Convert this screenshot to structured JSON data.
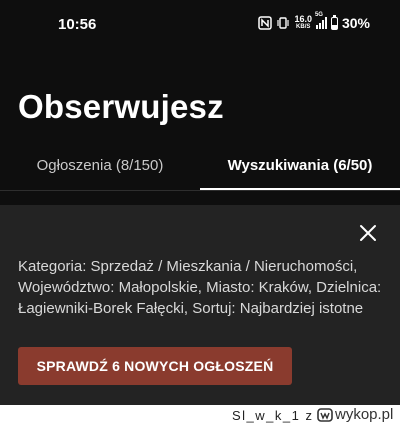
{
  "status_bar": {
    "time": "10:56",
    "net_speed_value": "16.0",
    "net_speed_unit": "KB/S",
    "network_gen": "5G",
    "battery": "30%",
    "battery_level": 0.3
  },
  "page": {
    "title": "Obserwujesz"
  },
  "tabs": [
    {
      "label": "Ogłoszenia (8/150)",
      "active": false
    },
    {
      "label": "Wyszukiwania (6/50)",
      "active": true
    }
  ],
  "saved_search": {
    "description": "Kategoria: Sprzedaż / Mieszkania / Nieruchomości, Województwo: Małopolskie, Miasto: Kraków, Dzielnica: Łagiewniki-Borek Fałęcki, Sortuj: Najbardziej istotne",
    "button_label": "SPRAWDŹ 6 NOWYCH OGŁOSZEŃ"
  },
  "watermark": {
    "user": "Sl_w_k_1 z",
    "site": "wykop.pl"
  },
  "colors": {
    "background": "#0e0e0e",
    "card": "#232323",
    "button": "#8a3b2e",
    "active_tab": "#ffffff",
    "inactive_tab": "#c9c9c9"
  }
}
